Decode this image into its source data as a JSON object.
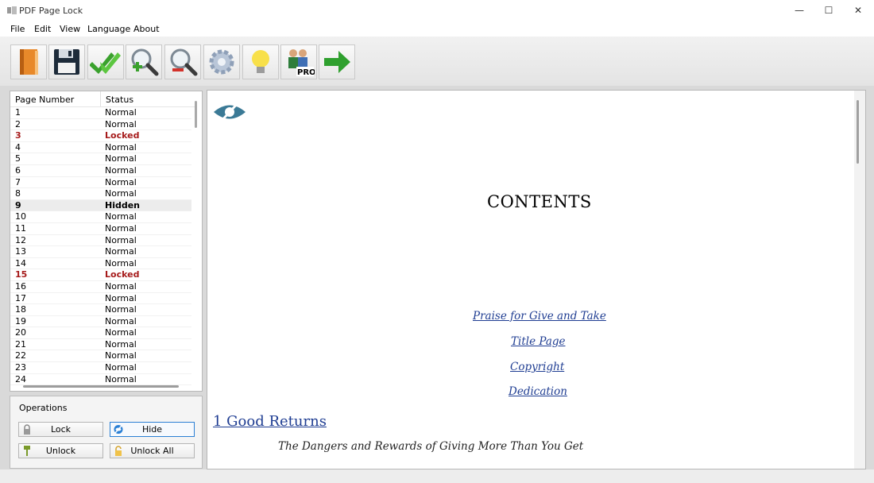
{
  "window": {
    "title": "PDF Page Lock",
    "min": "—",
    "max": "☐",
    "close": "✕"
  },
  "menu": [
    "File",
    "Edit",
    "View",
    "Language",
    "About"
  ],
  "toolbar": [
    {
      "name": "open-pdf-button",
      "icon": "book-icon"
    },
    {
      "name": "save-button",
      "icon": "floppy-disk-icon"
    },
    {
      "name": "apply-button",
      "icon": "double-check-icon"
    },
    {
      "name": "zoom-in-button",
      "icon": "zoom-in-icon"
    },
    {
      "name": "zoom-out-button",
      "icon": "zoom-out-icon"
    },
    {
      "name": "settings-button",
      "icon": "gear-icon"
    },
    {
      "name": "tips-button",
      "icon": "lightbulb-icon"
    },
    {
      "name": "pro-upgrade-button",
      "icon": "pro-users-icon",
      "badge": "PRO"
    },
    {
      "name": "exit-button",
      "icon": "green-arrow-icon"
    }
  ],
  "page_list": {
    "col_page": "Page Number",
    "col_status": "Status",
    "rows": [
      {
        "page": "1",
        "status": "Normal"
      },
      {
        "page": "2",
        "status": "Normal"
      },
      {
        "page": "3",
        "status": "Locked"
      },
      {
        "page": "4",
        "status": "Normal"
      },
      {
        "page": "5",
        "status": "Normal"
      },
      {
        "page": "6",
        "status": "Normal"
      },
      {
        "page": "7",
        "status": "Normal"
      },
      {
        "page": "8",
        "status": "Normal"
      },
      {
        "page": "9",
        "status": "Hidden"
      },
      {
        "page": "10",
        "status": "Normal"
      },
      {
        "page": "11",
        "status": "Normal"
      },
      {
        "page": "12",
        "status": "Normal"
      },
      {
        "page": "13",
        "status": "Normal"
      },
      {
        "page": "14",
        "status": "Normal"
      },
      {
        "page": "15",
        "status": "Locked"
      },
      {
        "page": "16",
        "status": "Normal"
      },
      {
        "page": "17",
        "status": "Normal"
      },
      {
        "page": "18",
        "status": "Normal"
      },
      {
        "page": "19",
        "status": "Normal"
      },
      {
        "page": "20",
        "status": "Normal"
      },
      {
        "page": "21",
        "status": "Normal"
      },
      {
        "page": "22",
        "status": "Normal"
      },
      {
        "page": "23",
        "status": "Normal"
      },
      {
        "page": "24",
        "status": "Normal"
      }
    ]
  },
  "operations": {
    "title": "Operations",
    "lock": "Lock",
    "hide": "Hide",
    "unlock": "Unlock",
    "unlock_all": "Unlock All"
  },
  "document": {
    "heading": "CONTENTS",
    "links": [
      "Praise for Give and Take",
      "Title Page",
      "Copyright",
      "Dedication"
    ],
    "chapter": "1 Good Returns",
    "chapter_subtitle": "The Dangers and Rewards of Giving More Than You Get"
  },
  "colors": {
    "locked": "#a61b1b",
    "link": "#1f3d92",
    "accent": "#2a7fd4"
  }
}
